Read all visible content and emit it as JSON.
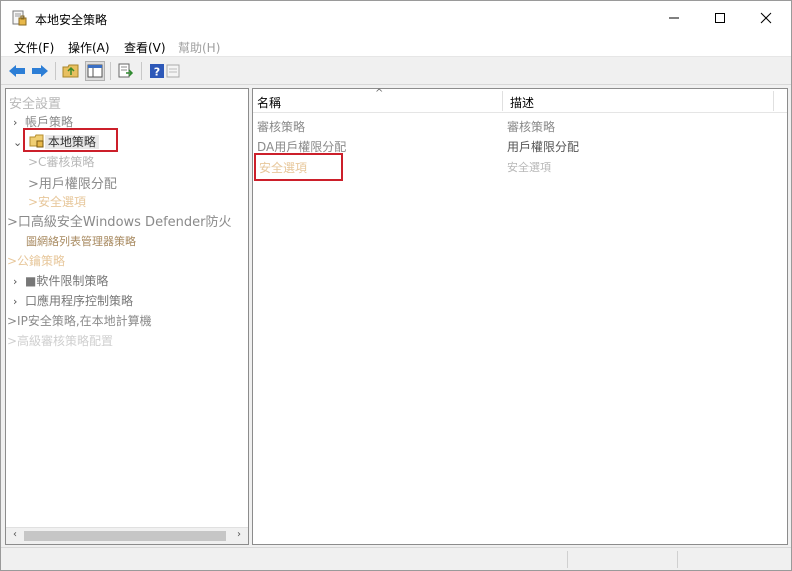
{
  "window": {
    "title": "本地安全策略",
    "controls": {
      "minimize": "—",
      "maximize": "☐",
      "close": "✕"
    }
  },
  "menu": [
    {
      "label": "文件(F)",
      "enabled": true
    },
    {
      "label": "操作(A)",
      "enabled": true
    },
    {
      "label": "查看(V)",
      "enabled": true
    },
    {
      "label": "幫助(H)",
      "enabled": false
    }
  ],
  "toolbar": {
    "buttons": [
      "back-icon",
      "forward-icon",
      "up-folder-icon",
      "show-hide-tree-icon",
      "export-list-icon",
      "help-icon",
      "properties-icon"
    ]
  },
  "tree": {
    "root": "安全設置",
    "items": [
      {
        "label": "帳戶策略",
        "arrow": "›"
      },
      {
        "label": "本地策略",
        "arrow": "⌄"
      },
      {
        "label": ">C審核策略"
      },
      {
        "label": ">用戶權限分配"
      },
      {
        "label": ">安全選項"
      },
      {
        "label": ">口高級安全Windows Defender防火"
      },
      {
        "label": "圖網絡列表管理器策略"
      },
      {
        "label": ">公鑰策略"
      },
      {
        "label": "■軟件限制策略",
        "arrow": "›"
      },
      {
        "label": "口應用程序控制策略",
        "arrow": "›"
      },
      {
        "label": ">IP安全策略,在本地計算機"
      },
      {
        "label": ">高級審核策略配置"
      }
    ]
  },
  "list": {
    "columns": [
      "名稱",
      "描述"
    ],
    "rows": [
      {
        "name": "審核策略",
        "desc": "審核策略"
      },
      {
        "name": "DA用戶權限分配",
        "desc": "用戶權限分配"
      },
      {
        "name": "安全選項",
        "desc": "安全選項"
      }
    ]
  },
  "colors": {
    "highlight": "#cc1f2a",
    "selection": "#e8e8e8"
  }
}
